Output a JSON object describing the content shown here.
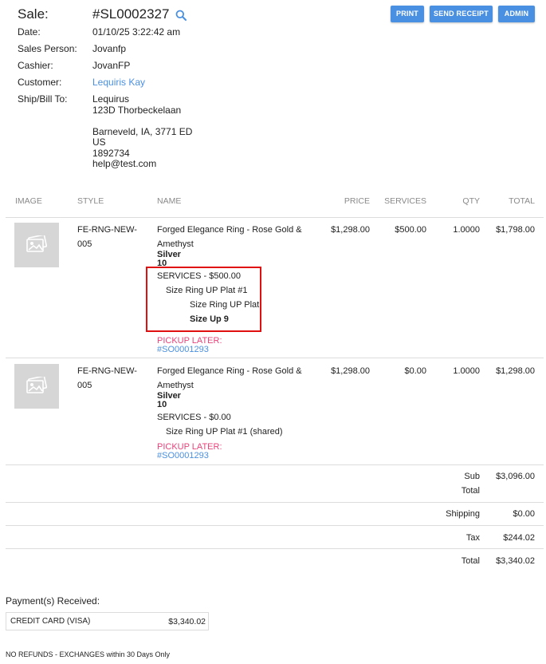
{
  "header": {
    "sale_label": "Sale:",
    "sale_id": "#SL0002327",
    "fields": [
      {
        "label": "Date:",
        "value": "01/10/25 3:22:42 am"
      },
      {
        "label": "Sales Person:",
        "value": "Jovanfp"
      },
      {
        "label": "Cashier:",
        "value": "JovanFP"
      },
      {
        "label": "Customer:",
        "value": "Lequiris Kay"
      },
      {
        "label": "Ship/Bill To:",
        "value": "Lequirus"
      }
    ],
    "address": {
      "line1": "123D Thorbeckelaan",
      "city": "Barneveld, IA, 3771 ED",
      "country": "US",
      "phone": "1892734",
      "email": "help@test.com"
    }
  },
  "buttons": {
    "print": "PRINT",
    "send_receipt": "SEND RECEIPT",
    "admin": "ADMIN"
  },
  "table": {
    "columns": [
      "IMAGE",
      "STYLE",
      "NAME",
      "PRICE",
      "SERVICES",
      "QTY",
      "TOTAL"
    ],
    "rows": [
      {
        "style_line1": "FE-RNG-NEW-",
        "style_line2": "005",
        "name_line1": "Forged Elegance Ring - Rose Gold &",
        "name_line2": "Amethyst",
        "metal": "Silver",
        "size": "10",
        "services_header": "SERVICES - $500.00",
        "service_item": "Size Ring UP Plat #1",
        "service_sub1": "Size Ring UP Plat",
        "service_sub2": "Size Up 9",
        "pickup_label": "PICKUP LATER:",
        "pickup_order": "#SO0001293",
        "price": "$1,298.00",
        "services": "$500.00",
        "qty": "1.0000",
        "total": "$1,798.00"
      },
      {
        "style_line1": "FE-RNG-NEW-",
        "style_line2": "005",
        "name_line1": "Forged Elegance Ring - Rose Gold &",
        "name_line2": "Amethyst",
        "metal": "Silver",
        "size": "10",
        "services_header": "SERVICES - $0.00",
        "service_item": "Size Ring UP Plat #1 (shared)",
        "pickup_label": "PICKUP LATER:",
        "pickup_order": "#SO0001293",
        "price": "$1,298.00",
        "services": "$0.00",
        "qty": "1.0000",
        "total": "$1,298.00"
      }
    ]
  },
  "totals": {
    "sub_label_1": "Sub",
    "sub_label_2": "Total",
    "sub_value": "$3,096.00",
    "shipping_label": "Shipping",
    "shipping_value": "$0.00",
    "tax_label": "Tax",
    "tax_value": "$244.02",
    "total_label": "Total",
    "total_value": "$3,340.02"
  },
  "payments": {
    "title": "Payment(s) Received:",
    "method": "CREDIT CARD (VISA)",
    "amount": "$3,340.02"
  },
  "footer": {
    "policy": "NO REFUNDS - EXCHANGES within 30 Days Only"
  },
  "colors": {
    "accent": "#4a90e2",
    "pickup": "#e8437a",
    "highlight_box": "#e01010"
  }
}
